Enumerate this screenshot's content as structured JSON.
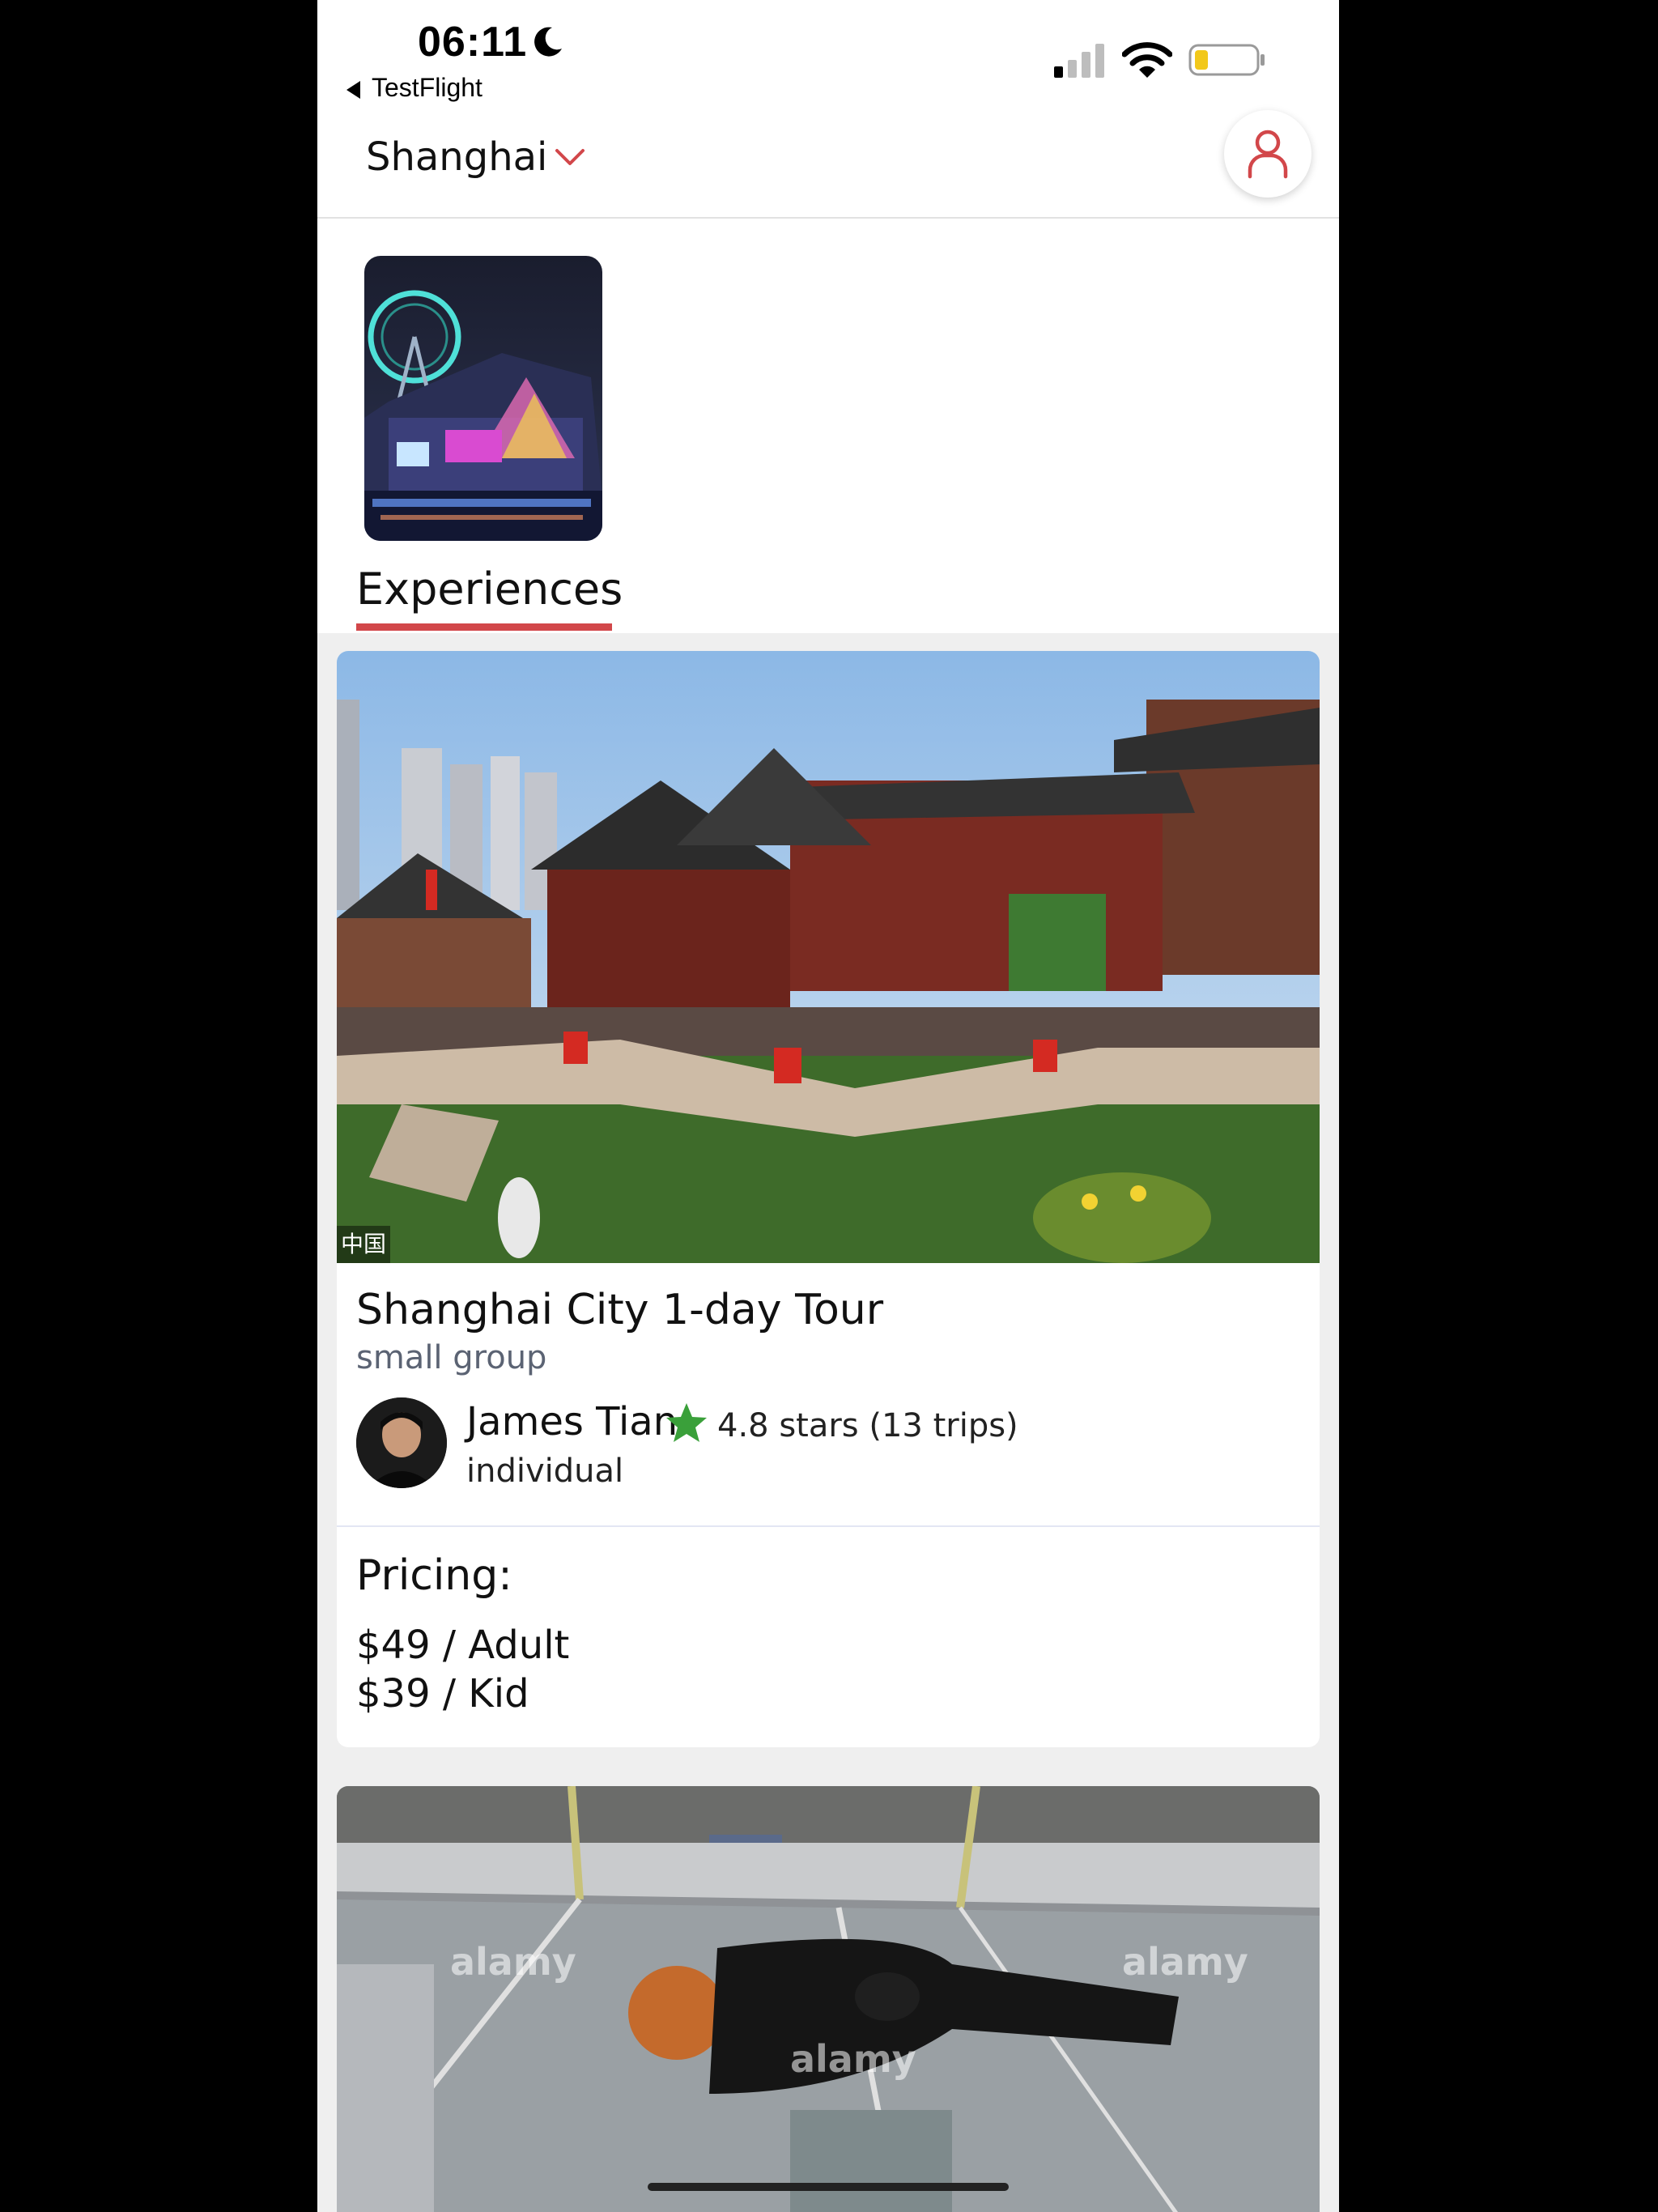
{
  "status_bar": {
    "time": "06:11",
    "back_app": "TestFlight"
  },
  "header": {
    "city": "Shanghai"
  },
  "tabs": {
    "experiences": "Experiences"
  },
  "experience_card": {
    "title": "Shanghai City 1-day Tour",
    "subtitle": "small group",
    "photo_tag": "中国",
    "guide": {
      "name": "James Tian",
      "rating": "4.8 stars (13 trips)",
      "type": "individual"
    },
    "pricing_title": "Pricing:",
    "prices": [
      "$49 / Adult",
      "$39 / Kid"
    ]
  },
  "watermarks": [
    "alamy",
    "alamy",
    "alamy"
  ],
  "colors": {
    "accent": "#d2474a",
    "star": "#3aa03a",
    "subtitle": "#5b6373"
  },
  "icons": [
    "moon-icon",
    "signal-icon",
    "wifi-icon",
    "battery-icon",
    "chevron-down-icon",
    "user-icon",
    "star-icon"
  ]
}
